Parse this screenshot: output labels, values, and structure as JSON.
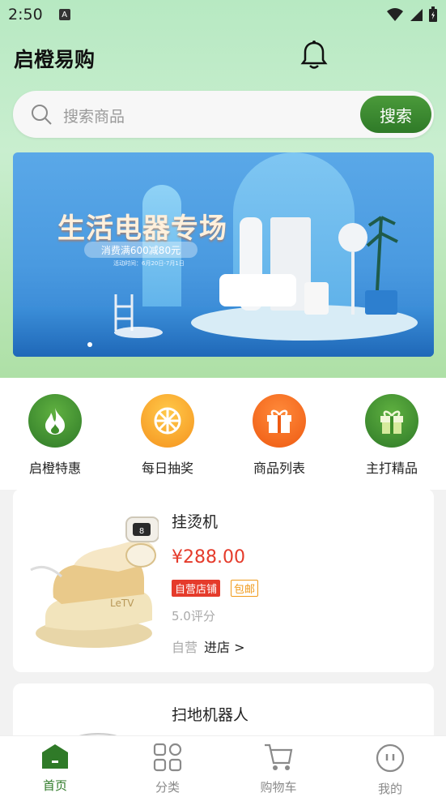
{
  "status_bar": {
    "time": "2:50",
    "notif": "A"
  },
  "header": {
    "title": "启橙易购",
    "bell_icon": "bell-icon"
  },
  "search": {
    "placeholder": "搜索商品",
    "button": "搜索"
  },
  "banner": {
    "headline": "生活电器专场",
    "subline": "消费满600减80元",
    "fine_print": "活动时间：6月20日-7月1日"
  },
  "quick_menu": [
    {
      "label": "启橙特惠",
      "icon": "flame-icon",
      "color": "#3f8f2a"
    },
    {
      "label": "每日抽奖",
      "icon": "wheel-icon",
      "color": "#f7a52a"
    },
    {
      "label": "商品列表",
      "icon": "gift-box-icon",
      "color": "#f06a1c"
    },
    {
      "label": "主打精品",
      "icon": "present-icon",
      "color": "#3f8f2a"
    }
  ],
  "products": [
    {
      "name": "挂烫机",
      "price": "¥288.00",
      "tag_store": "自营店铺",
      "tag_shipping": "包邮",
      "rating": "5.0评分",
      "self_run": "自营",
      "enter": "进店 >"
    },
    {
      "name": "扫地机器人"
    }
  ],
  "tabbar": [
    {
      "label": "首页",
      "icon": "home-icon",
      "active": true
    },
    {
      "label": "分类",
      "icon": "grid-icon",
      "active": false
    },
    {
      "label": "购物车",
      "icon": "cart-icon",
      "active": false
    },
    {
      "label": "我的",
      "icon": "profile-icon",
      "active": false
    }
  ],
  "colors": {
    "accent": "#2f7a28",
    "price": "#e53b2b",
    "shipping_tag": "#f09a1a"
  }
}
